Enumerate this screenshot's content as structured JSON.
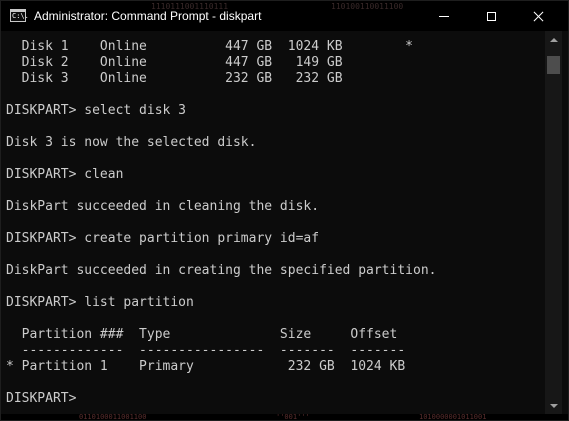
{
  "window": {
    "title": "Administrator: Command Prompt - diskpart",
    "icon_label": "C:\\.",
    "icon_name": "command-prompt-icon",
    "caption_buttons": {
      "minimize_icon": "minimize-icon",
      "maximize_icon": "maximize-icon",
      "close_icon": "close-icon"
    },
    "background_code": [
      "1110111001110111",
      "110100110011100"
    ]
  },
  "console": {
    "background_color": "#0c0c0c",
    "text_color": "#cccccc",
    "lines": [
      "  Disk 1    Online          447 GB  1024 KB        *",
      "  Disk 2    Online          447 GB   149 GB",
      "  Disk 3    Online          232 GB   232 GB",
      "",
      "DISKPART> select disk 3",
      "",
      "Disk 3 is now the selected disk.",
      "",
      "DISKPART> clean",
      "",
      "DiskPart succeeded in cleaning the disk.",
      "",
      "DISKPART> create partition primary id=af",
      "",
      "DiskPart succeeded in creating the specified partition.",
      "",
      "DISKPART> list partition",
      "",
      "  Partition ###  Type              Size     Offset",
      "  -------------  ----------------  -------  -------",
      "* Partition 1    Primary            232 GB  1024 KB",
      "",
      "DISKPART> "
    ]
  },
  "scrollbar": {
    "up_icon": "scroll-up-arrow-icon",
    "down_icon": "scroll-down-arrow-icon",
    "position": 0.03
  },
  "footer_code": [
    "0110100011001100",
    "''001'''",
    "1010000001011001"
  ]
}
